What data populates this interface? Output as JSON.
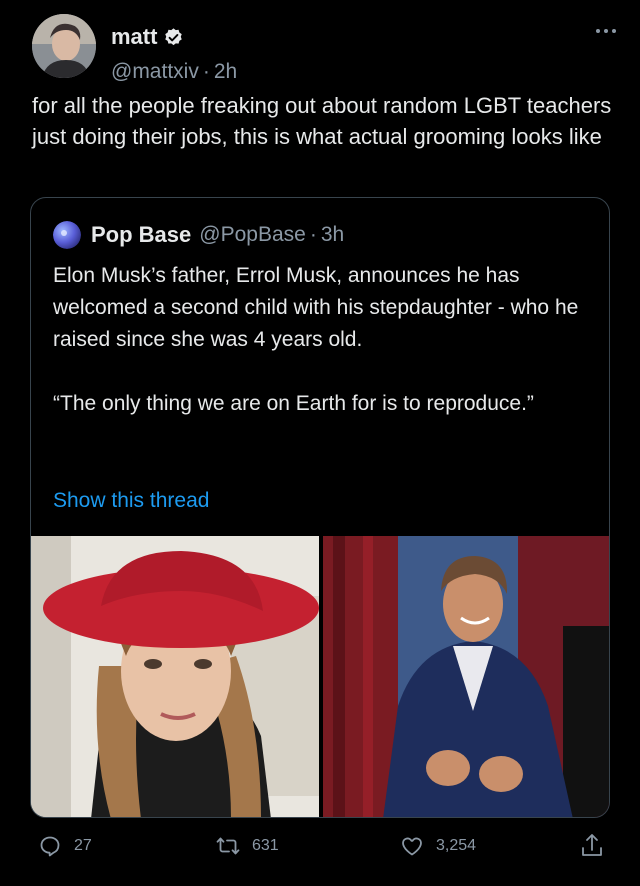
{
  "tweet": {
    "author_name": "matt",
    "author_handle": "@mattxiv",
    "separator": "·",
    "time": "2h",
    "text": "for all the people freaking out about random LGBT teachers just doing their jobs, this is what actual grooming looks like"
  },
  "quoted": {
    "author_name": "Pop Base",
    "author_handle": "@PopBase",
    "separator": "·",
    "time": "3h",
    "text": "Elon Musk’s father, Errol Musk, announces he has welcomed a second child with his stepdaughter - who he raised since she was 4 years old.\n\n“The only thing we are on Earth for is to reproduce.”",
    "link": "Show this thread"
  },
  "actions": {
    "replies": "27",
    "retweets": "631",
    "likes": "3,254"
  },
  "icons": {
    "verified": "verified-badge-icon",
    "more": "more-dots-icon",
    "reply": "reply-icon",
    "retweet": "retweet-icon",
    "like": "heart-icon",
    "share": "share-icon"
  },
  "colors": {
    "background": "#000000",
    "text": "#e7e9ea",
    "secondary": "#8b98a5",
    "link": "#1d9bf0",
    "border": "#38444d"
  }
}
